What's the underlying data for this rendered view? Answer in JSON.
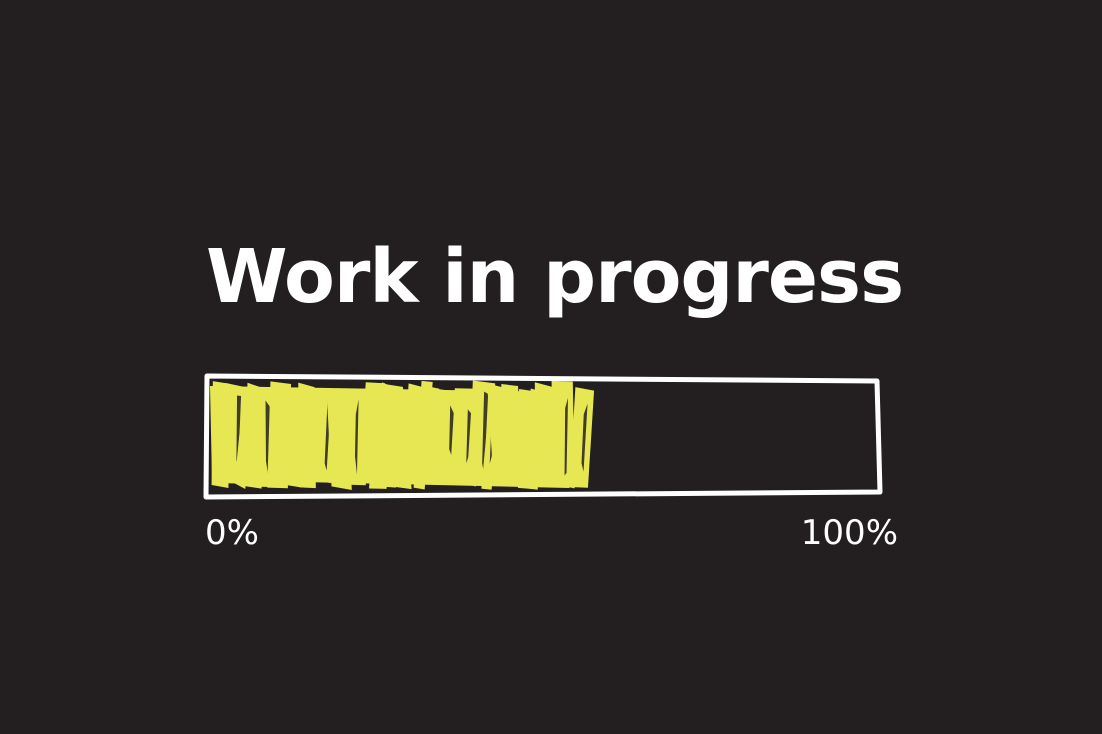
{
  "title": "Work in progress",
  "progress": {
    "value": 0.55,
    "min_label": "0%",
    "max_label": "100%",
    "fill_color": "#e6e752",
    "frame_color": "#ffffff"
  },
  "background_color": "#231f20"
}
